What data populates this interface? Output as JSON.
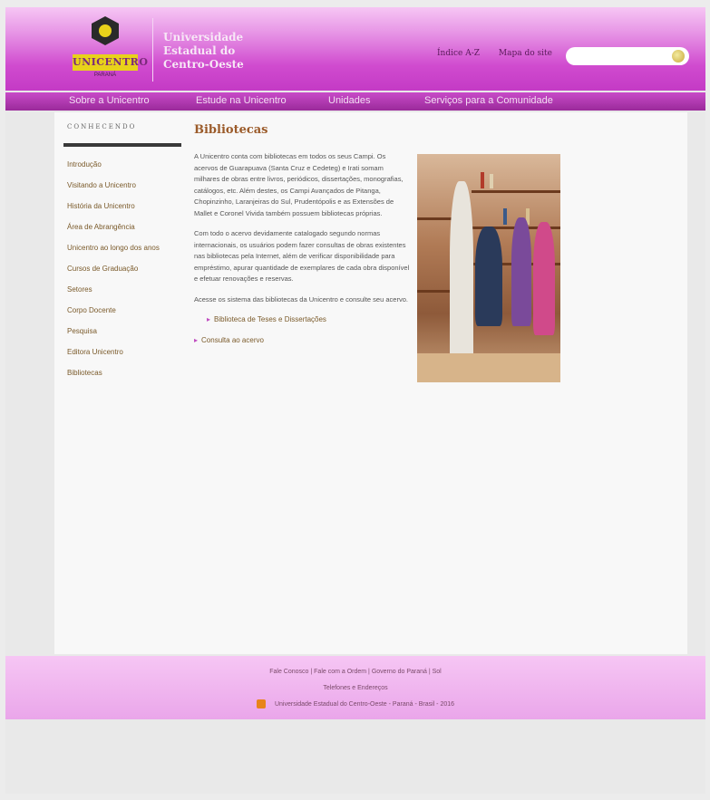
{
  "header": {
    "logo_text": "UNICENTRO",
    "logo_sub": "PARANÁ",
    "univ_line1": "Universidade",
    "univ_line2": "Estadual do",
    "univ_line3": "Centro-Oeste",
    "link_az": "Índice A-Z",
    "link_map": "Mapa do site",
    "search_placeholder": ""
  },
  "nav": {
    "items": [
      "Sobre a Unicentro",
      "Estude na Unicentro",
      "Unidades",
      "Serviços para a Comunidade"
    ]
  },
  "sidebar": {
    "title": "CONHECENDO",
    "items": [
      "Introdução",
      "Visitando a Unicentro",
      "História da Unicentro",
      "Área de Abrangência",
      "Unicentro ao longo dos anos",
      "Cursos de Graduação",
      "Setores",
      "Corpo Docente",
      "Pesquisa",
      "Editora Unicentro",
      "Bibliotecas"
    ]
  },
  "main": {
    "title": "Bibliotecas",
    "para1": "A Unicentro conta com bibliotecas em todos os seus Campi. Os acervos de Guarapuava (Santa Cruz e Cedeteg) e Irati somam milhares de obras entre livros, periódicos, dissertações, monografias, catálogos, etc. Além destes, os Campi Avançados de Pitanga, Chopinzinho, Laranjeiras do Sul, Prudentópolis e as Extensões de Mallet e Coronel Vivida também possuem bibliotecas próprias.",
    "para2": "Com todo o acervo devidamente catalogado segundo normas internacionais, os usuários podem fazer consultas de obras existentes nas bibliotecas pela Internet, além de verificar disponibilidade para empréstimo, apurar quantidade de exemplares de cada obra disponível e efetuar renovações e reservas.",
    "para3": "Acesse os sistema das bibliotecas da Unicentro e consulte seu acervo.",
    "links": [
      "Biblioteca de Teses e Dissertações",
      "Consulta ao acervo"
    ]
  },
  "footer": {
    "line1": "Fale Conosco | Fale com a Ordem | Governo do Paraná | Sol",
    "line2": "Telefones e Endereços",
    "line3": "Universidade Estadual do Centro-Oeste - Paraná - Brasil - 2016"
  }
}
